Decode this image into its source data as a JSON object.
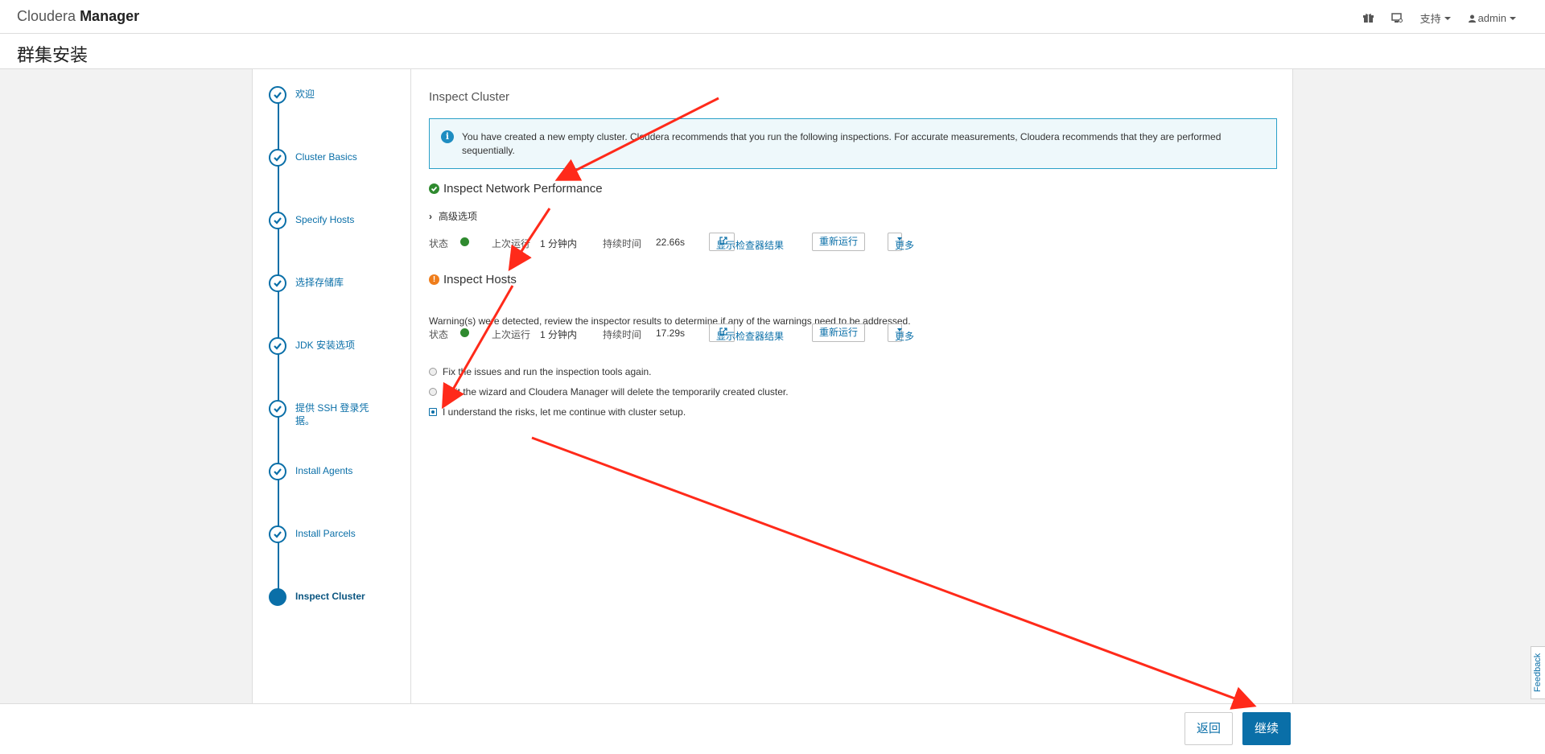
{
  "app": {
    "brand_light": "Cloudera",
    "brand_bold": "Manager",
    "nav": {
      "support": "支持",
      "user": "admin"
    }
  },
  "page": {
    "title": "群集安装"
  },
  "steps": [
    {
      "label": "欢迎",
      "state": "done"
    },
    {
      "label": "Cluster Basics",
      "state": "done"
    },
    {
      "label": "Specify Hosts",
      "state": "done"
    },
    {
      "label": "选择存储库",
      "state": "done"
    },
    {
      "label": "JDK 安装选项",
      "state": "done"
    },
    {
      "label": "提供 SSH 登录凭据。",
      "state": "done"
    },
    {
      "label": "Install Agents",
      "state": "done"
    },
    {
      "label": "Install Parcels",
      "state": "done"
    },
    {
      "label": "Inspect Cluster",
      "state": "active"
    }
  ],
  "main": {
    "title": "Inspect Cluster",
    "alert": "You have created a new empty cluster. Cloudera recommends that you run the following inspections. For accurate measurements, Cloudera recommends that they are performed sequentially.",
    "network": {
      "title": "Inspect Network Performance",
      "advanced": "高级选项",
      "status_label": "状态",
      "last_run_label": "上次运行",
      "last_run": "1 分钟内",
      "duration_label": "持续时间",
      "duration": "22.66s",
      "show_results": "显示检查器结果",
      "rerun": "重新运行",
      "more": "更多"
    },
    "hosts": {
      "title": "Inspect Hosts",
      "warning": "Warning(s) were detected, review the inspector results to determine if any of the warnings need to be addressed.",
      "status_label": "状态",
      "last_run_label": "上次运行",
      "last_run": "1 分钟内",
      "duration_label": "持续时间",
      "duration": "17.29s",
      "show_results": "显示检查器结果",
      "rerun": "重新运行",
      "more": "更多"
    },
    "options": [
      {
        "label": "Fix the issues and run the inspection tools again.",
        "selected": false
      },
      {
        "label": "Quit the wizard and Cloudera Manager will delete the temporarily created cluster.",
        "selected": false
      },
      {
        "label": "I understand the risks, let me continue with cluster setup.",
        "selected": true
      }
    ]
  },
  "footer": {
    "back": "返回",
    "next": "继续"
  },
  "feedback": "Feedback",
  "colors": {
    "accent": "#0a6fa8",
    "success": "#2f8a2f",
    "warning": "#ef7d1b",
    "annotation": "#ff2a1a"
  }
}
